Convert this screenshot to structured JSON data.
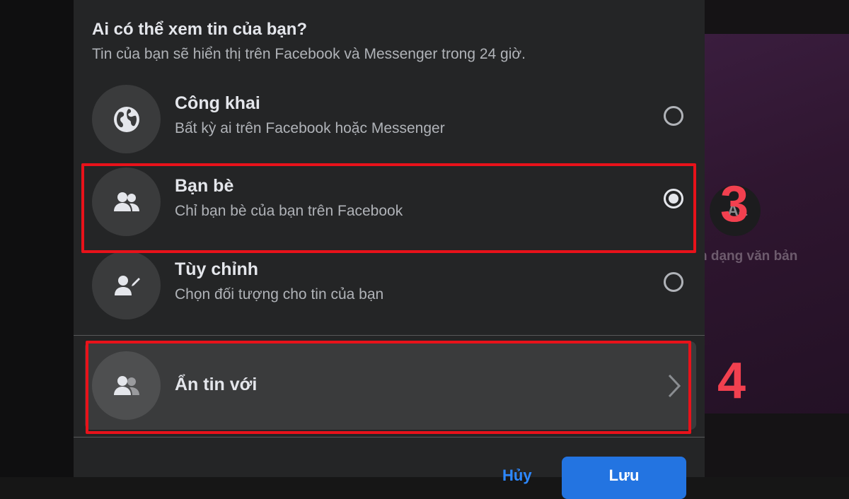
{
  "dialog": {
    "title": "Ai có thể xem tin của bạn?",
    "subtitle": "Tin của bạn sẽ hiển thị trên Facebook và Messenger trong 24 giờ."
  },
  "options": [
    {
      "title": "Công khai",
      "description": "Bất kỳ ai trên Facebook hoặc Messenger",
      "icon": "globe-icon",
      "selected": false
    },
    {
      "title": "Bạn bè",
      "description": "Chỉ bạn bè của bạn trên Facebook",
      "icon": "friends-icon",
      "selected": true
    },
    {
      "title": "Tùy chỉnh",
      "description": "Chọn đối tượng cho tin của bạn",
      "icon": "custom-audience-icon",
      "selected": false
    }
  ],
  "hide_story": {
    "label": "Ẩn tin với",
    "icon": "hide-from-icon"
  },
  "footer": {
    "cancel_label": "Hủy",
    "save_label": "Lưu"
  },
  "preview": {
    "aa_label": "Aa",
    "text_label": "n dạng văn bản"
  },
  "annotations": {
    "step3": "3",
    "step4": "4",
    "highlight_color": "#e8121a",
    "number_color": "#f2404f"
  },
  "colors": {
    "dialog_bg": "#242526",
    "accent": "#2374e1"
  }
}
